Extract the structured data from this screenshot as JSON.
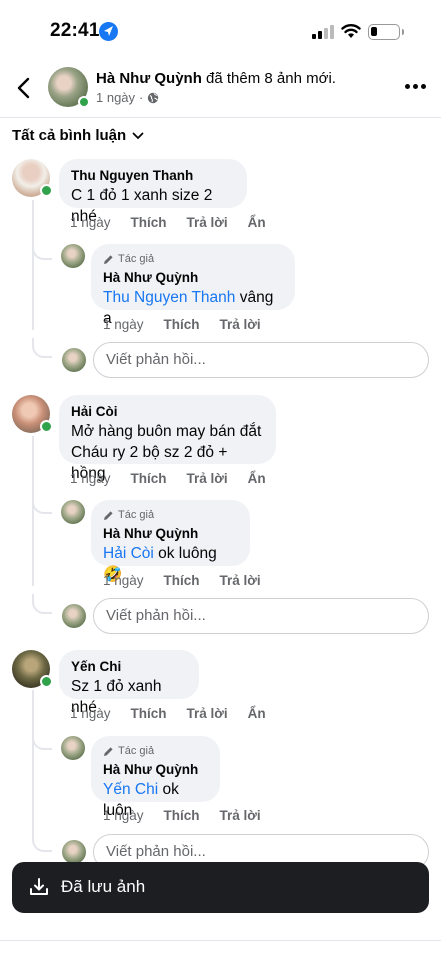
{
  "status_bar": {
    "time": "22:41",
    "location_icon": "location-arrow-icon",
    "signal_icon": "cellular-signal-icon",
    "wifi_icon": "wifi-icon",
    "battery_icon": "battery-low-icon"
  },
  "header": {
    "back_icon": "chevron-left-icon",
    "author": "Hà Như Quỳnh",
    "action": " đã thêm 8 ảnh mới.",
    "time": "1 ngày",
    "privacy_icon": "globe-icon",
    "more_icon": "ellipsis-icon"
  },
  "filter": {
    "label": "Tất cả bình luận",
    "icon": "chevron-down-icon"
  },
  "labels": {
    "like": "Thích",
    "reply": "Trả lời",
    "hide": "Ẩn",
    "author_badge": "Tác giả",
    "reply_placeholder": "Viết phản hồi..."
  },
  "comments": [
    {
      "name": "Thu Nguyen Thanh",
      "lines": [
        "C 1 đỏ 1 xanh size 2 nhé"
      ],
      "time": "1 ngày",
      "reply": {
        "name": "Hà Như Quỳnh",
        "tag": "Thu Nguyen Thanh",
        "text": " vâng ạ",
        "time": "1 ngày"
      }
    },
    {
      "name": "Hải Còi",
      "lines": [
        "Mở hàng buôn may bán đắt",
        "Cháu ry 2 bộ sz 2 đỏ + hồng"
      ],
      "time": "1 ngày",
      "reply": {
        "name": "Hà Như Quỳnh",
        "tag": "Hải Còi",
        "text": " ok luông 🤣",
        "time": "1 ngày"
      }
    },
    {
      "name": "Yến Chi",
      "lines": [
        "Sz 1 đỏ xanh nhé"
      ],
      "time": "1 ngày",
      "reply": {
        "name": "Hà Như Quỳnh",
        "tag": "Yến Chi",
        "text": " ok luôn",
        "time": "1 ngày"
      }
    }
  ],
  "toast": {
    "icon": "download-icon",
    "label": "Đã lưu ảnh"
  },
  "colors": {
    "accent": "#1877f2",
    "online": "#31a24c",
    "bubble": "#f0f2f5",
    "secondary_text": "#65676b",
    "toast_bg": "#1c1e21"
  }
}
